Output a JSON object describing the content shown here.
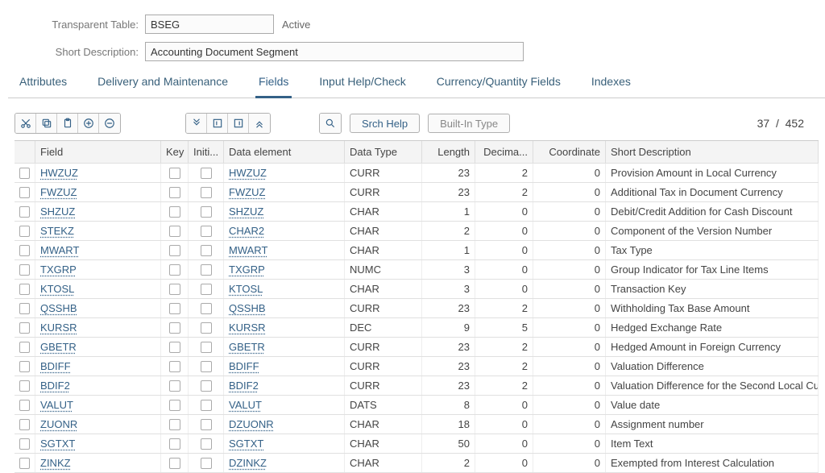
{
  "header": {
    "table_label": "Transparent Table:",
    "table_name": "BSEG",
    "status": "Active",
    "short_desc_label": "Short Description:",
    "short_desc": "Accounting Document Segment"
  },
  "tabs": {
    "items": [
      {
        "label": "Attributes",
        "active": false
      },
      {
        "label": "Delivery and Maintenance",
        "active": false
      },
      {
        "label": "Fields",
        "active": true
      },
      {
        "label": "Input Help/Check",
        "active": false
      },
      {
        "label": "Currency/Quantity Fields",
        "active": false
      },
      {
        "label": "Indexes",
        "active": false
      }
    ]
  },
  "toolbar": {
    "srch_help": "Srch Help",
    "builtin_type": "Built-In Type",
    "counter_pos": "37",
    "counter_sep": "/",
    "counter_total": "452"
  },
  "columns": {
    "field": "Field",
    "key": "Key",
    "init": "Initi...",
    "de": "Data element",
    "dt": "Data Type",
    "len": "Length",
    "dec": "Decima...",
    "coord": "Coordinate",
    "sd": "Short Description"
  },
  "rows": [
    {
      "field": "HWZUZ",
      "de": "HWZUZ",
      "dt": "CURR",
      "len": "23",
      "dec": "2",
      "coord": "0",
      "sd": "Provision Amount in Local Currency"
    },
    {
      "field": "FWZUZ",
      "de": "FWZUZ",
      "dt": "CURR",
      "len": "23",
      "dec": "2",
      "coord": "0",
      "sd": "Additional Tax in Document Currency"
    },
    {
      "field": "SHZUZ",
      "de": "SHZUZ",
      "dt": "CHAR",
      "len": "1",
      "dec": "0",
      "coord": "0",
      "sd": "Debit/Credit Addition for Cash Discount"
    },
    {
      "field": "STEKZ",
      "de": "CHAR2",
      "dt": "CHAR",
      "len": "2",
      "dec": "0",
      "coord": "0",
      "sd": "Component of the Version Number"
    },
    {
      "field": "MWART",
      "de": "MWART",
      "dt": "CHAR",
      "len": "1",
      "dec": "0",
      "coord": "0",
      "sd": "Tax Type"
    },
    {
      "field": "TXGRP",
      "de": "TXGRP",
      "dt": "NUMC",
      "len": "3",
      "dec": "0",
      "coord": "0",
      "sd": "Group Indicator for Tax Line Items"
    },
    {
      "field": "KTOSL",
      "de": "KTOSL",
      "dt": "CHAR",
      "len": "3",
      "dec": "0",
      "coord": "0",
      "sd": "Transaction Key"
    },
    {
      "field": "QSSHB",
      "de": "QSSHB",
      "dt": "CURR",
      "len": "23",
      "dec": "2",
      "coord": "0",
      "sd": "Withholding Tax Base Amount"
    },
    {
      "field": "KURSR",
      "de": "KURSR",
      "dt": "DEC",
      "len": "9",
      "dec": "5",
      "coord": "0",
      "sd": "Hedged Exchange Rate"
    },
    {
      "field": "GBETR",
      "de": "GBETR",
      "dt": "CURR",
      "len": "23",
      "dec": "2",
      "coord": "0",
      "sd": "Hedged Amount in Foreign Currency"
    },
    {
      "field": "BDIFF",
      "de": "BDIFF",
      "dt": "CURR",
      "len": "23",
      "dec": "2",
      "coord": "0",
      "sd": "Valuation Difference"
    },
    {
      "field": "BDIF2",
      "de": "BDIF2",
      "dt": "CURR",
      "len": "23",
      "dec": "2",
      "coord": "0",
      "sd": "Valuation Difference for the Second Local Currency"
    },
    {
      "field": "VALUT",
      "de": "VALUT",
      "dt": "DATS",
      "len": "8",
      "dec": "0",
      "coord": "0",
      "sd": "Value date"
    },
    {
      "field": "ZUONR",
      "de": "DZUONR",
      "dt": "CHAR",
      "len": "18",
      "dec": "0",
      "coord": "0",
      "sd": "Assignment number"
    },
    {
      "field": "SGTXT",
      "de": "SGTXT",
      "dt": "CHAR",
      "len": "50",
      "dec": "0",
      "coord": "0",
      "sd": "Item Text"
    },
    {
      "field": "ZINKZ",
      "de": "DZINKZ",
      "dt": "CHAR",
      "len": "2",
      "dec": "0",
      "coord": "0",
      "sd": "Exempted from Interest Calculation"
    }
  ]
}
